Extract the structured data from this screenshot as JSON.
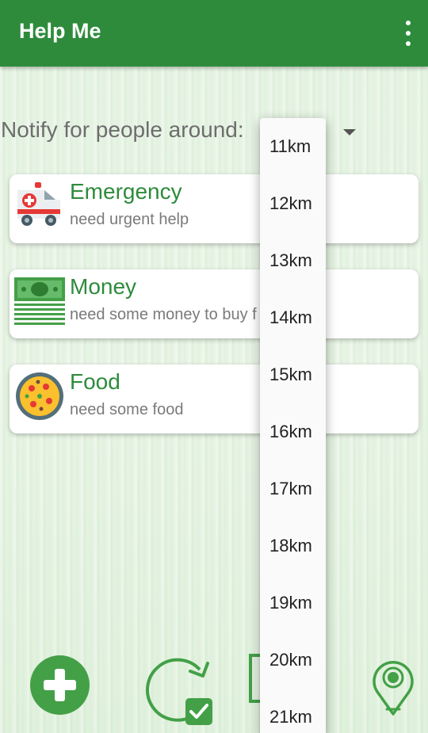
{
  "appbar": {
    "title": "Help Me",
    "menu_icon": "more-vert-icon",
    "color": "#2e8b3c"
  },
  "notify": {
    "label": "Notify for people around:"
  },
  "cards": [
    {
      "title": "Emergency",
      "subtitle": "need urgent help",
      "icon": "ambulance-icon"
    },
    {
      "title": "Money",
      "subtitle": "need some money to buy f",
      "icon": "money-icon"
    },
    {
      "title": "Food",
      "subtitle": "need some food",
      "icon": "food-pan-icon"
    }
  ],
  "dropdown": {
    "options": [
      "11km",
      "12km",
      "13km",
      "14km",
      "15km",
      "16km",
      "17km",
      "18km",
      "19km",
      "20km",
      "21km"
    ]
  },
  "bottom_bar": {
    "add_icon": "add-circle-icon",
    "refresh_icon": "refresh-check-icon",
    "middle_icon": "partial-icon",
    "location_icon": "location-pin-icon"
  }
}
